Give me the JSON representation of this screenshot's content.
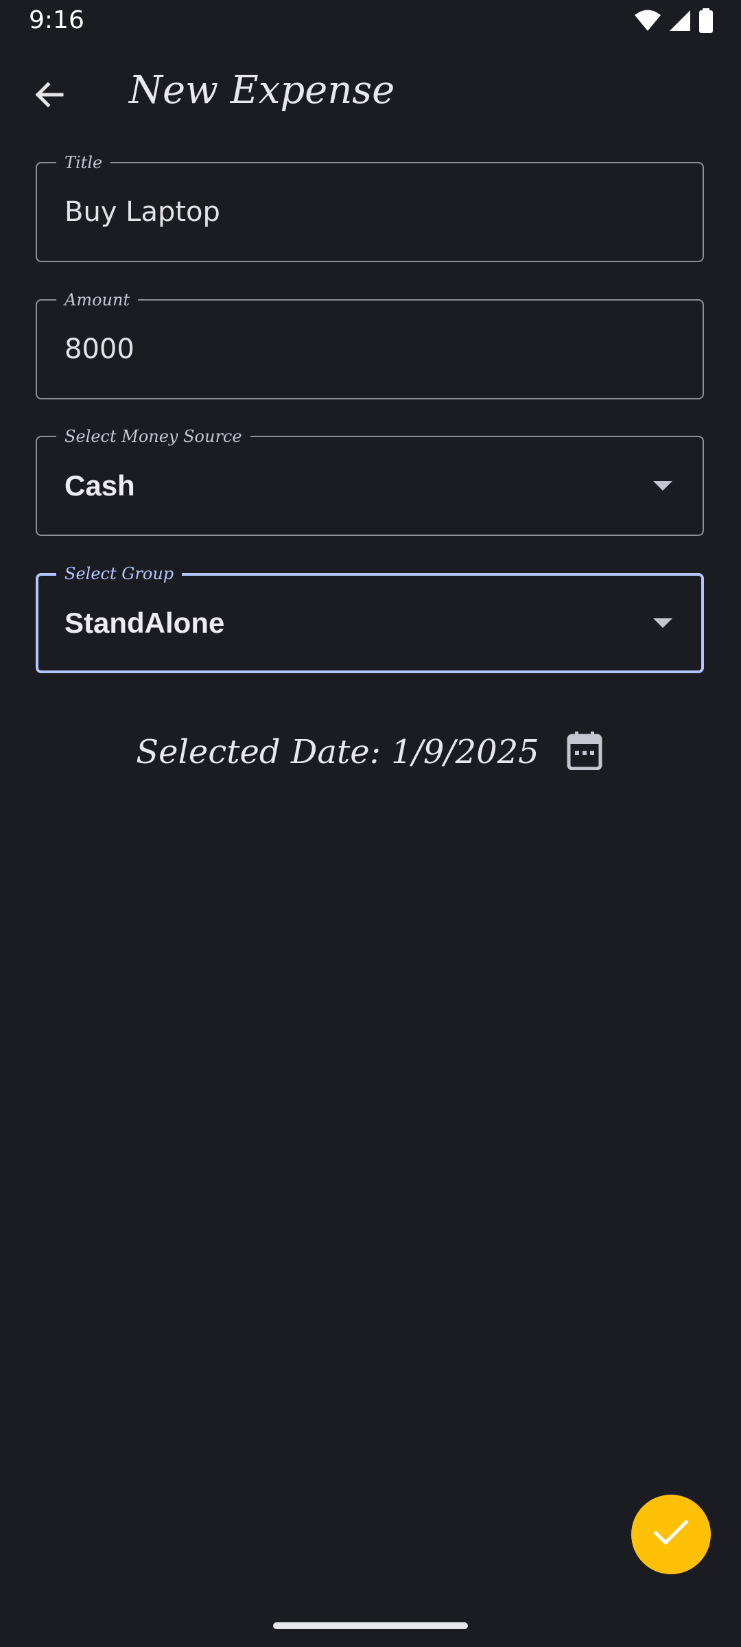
{
  "status_bar": {
    "time": "9:16",
    "icons": [
      "wifi-icon",
      "cellular-signal-icon",
      "battery-icon"
    ]
  },
  "app_bar": {
    "back_icon": "arrow-back-icon",
    "title": "New Expense"
  },
  "form": {
    "title_field": {
      "label": "Title",
      "value": "Buy Laptop"
    },
    "amount_field": {
      "label": "Amount",
      "value": "8000"
    },
    "money_source_field": {
      "label": "Select Money Source",
      "value": "Cash",
      "icon": "dropdown-arrow-icon"
    },
    "group_field": {
      "label": "Select Group",
      "value": "StandAlone",
      "icon": "dropdown-arrow-icon",
      "focused": true
    }
  },
  "date": {
    "text": "Selected Date: 1/9/2025",
    "icon": "calendar-icon"
  },
  "fab": {
    "icon": "check-icon"
  },
  "colors": {
    "background": "#1b1c21",
    "outline": "#8e9099",
    "focus_accent": "#b3c5ff",
    "fab": "#ffc107"
  }
}
